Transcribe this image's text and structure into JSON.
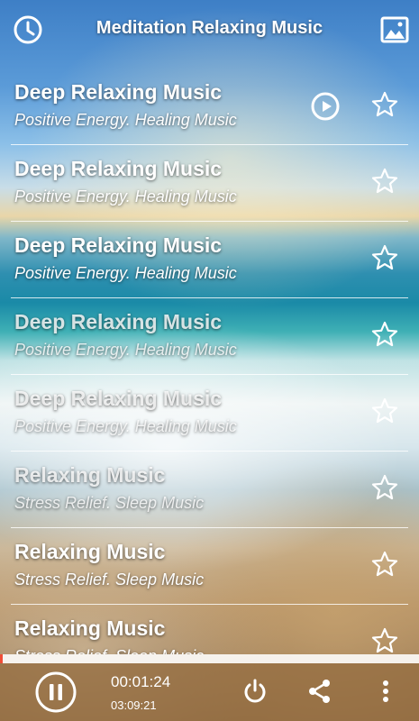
{
  "header": {
    "title": "Meditation Relaxing Music",
    "left_icon": "history-clock-icon",
    "right_icon": "wallpaper-image-icon"
  },
  "tracks": [
    {
      "title": "Deep Relaxing Music",
      "subtitle": "Positive Energy. Healing Music",
      "playing": true
    },
    {
      "title": "Deep Relaxing Music",
      "subtitle": "Positive Energy. Healing Music"
    },
    {
      "title": "Deep Relaxing Music",
      "subtitle": "Positive Energy. Healing Music"
    },
    {
      "title": "Deep Relaxing Music",
      "subtitle": "Positive Energy. Healing Music"
    },
    {
      "title": "Deep Relaxing Music",
      "subtitle": "Positive Energy. Healing Music"
    },
    {
      "title": "Relaxing Music",
      "subtitle": "Stress Relief. Sleep Music"
    },
    {
      "title": "Relaxing Music",
      "subtitle": "Stress Relief. Sleep Music"
    },
    {
      "title": "Relaxing Music",
      "subtitle": "Stress Relief. Sleep Music"
    }
  ],
  "player": {
    "current_time": "00:01:24",
    "total_time": "03:09:21",
    "progress": 0.0075,
    "state": "playing"
  },
  "colors": {
    "accent": "#f04e37",
    "bar": "#966e41"
  }
}
